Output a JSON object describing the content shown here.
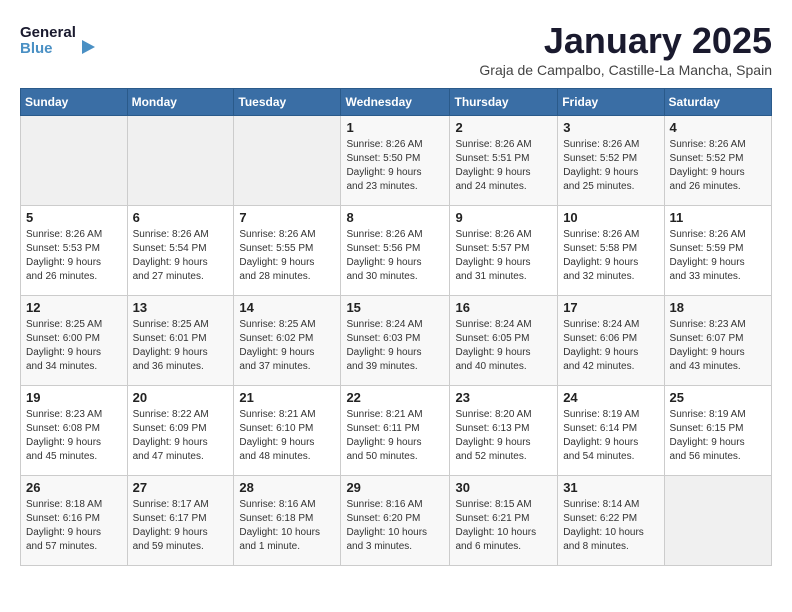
{
  "logo": {
    "line1": "General",
    "line2": "Blue"
  },
  "title": "January 2025",
  "subtitle": "Graja de Campalbo, Castille-La Mancha, Spain",
  "days_of_week": [
    "Sunday",
    "Monday",
    "Tuesday",
    "Wednesday",
    "Thursday",
    "Friday",
    "Saturday"
  ],
  "weeks": [
    [
      {
        "day": "",
        "info": ""
      },
      {
        "day": "",
        "info": ""
      },
      {
        "day": "",
        "info": ""
      },
      {
        "day": "1",
        "info": "Sunrise: 8:26 AM\nSunset: 5:50 PM\nDaylight: 9 hours\nand 23 minutes."
      },
      {
        "day": "2",
        "info": "Sunrise: 8:26 AM\nSunset: 5:51 PM\nDaylight: 9 hours\nand 24 minutes."
      },
      {
        "day": "3",
        "info": "Sunrise: 8:26 AM\nSunset: 5:52 PM\nDaylight: 9 hours\nand 25 minutes."
      },
      {
        "day": "4",
        "info": "Sunrise: 8:26 AM\nSunset: 5:52 PM\nDaylight: 9 hours\nand 26 minutes."
      }
    ],
    [
      {
        "day": "5",
        "info": "Sunrise: 8:26 AM\nSunset: 5:53 PM\nDaylight: 9 hours\nand 26 minutes."
      },
      {
        "day": "6",
        "info": "Sunrise: 8:26 AM\nSunset: 5:54 PM\nDaylight: 9 hours\nand 27 minutes."
      },
      {
        "day": "7",
        "info": "Sunrise: 8:26 AM\nSunset: 5:55 PM\nDaylight: 9 hours\nand 28 minutes."
      },
      {
        "day": "8",
        "info": "Sunrise: 8:26 AM\nSunset: 5:56 PM\nDaylight: 9 hours\nand 30 minutes."
      },
      {
        "day": "9",
        "info": "Sunrise: 8:26 AM\nSunset: 5:57 PM\nDaylight: 9 hours\nand 31 minutes."
      },
      {
        "day": "10",
        "info": "Sunrise: 8:26 AM\nSunset: 5:58 PM\nDaylight: 9 hours\nand 32 minutes."
      },
      {
        "day": "11",
        "info": "Sunrise: 8:26 AM\nSunset: 5:59 PM\nDaylight: 9 hours\nand 33 minutes."
      }
    ],
    [
      {
        "day": "12",
        "info": "Sunrise: 8:25 AM\nSunset: 6:00 PM\nDaylight: 9 hours\nand 34 minutes."
      },
      {
        "day": "13",
        "info": "Sunrise: 8:25 AM\nSunset: 6:01 PM\nDaylight: 9 hours\nand 36 minutes."
      },
      {
        "day": "14",
        "info": "Sunrise: 8:25 AM\nSunset: 6:02 PM\nDaylight: 9 hours\nand 37 minutes."
      },
      {
        "day": "15",
        "info": "Sunrise: 8:24 AM\nSunset: 6:03 PM\nDaylight: 9 hours\nand 39 minutes."
      },
      {
        "day": "16",
        "info": "Sunrise: 8:24 AM\nSunset: 6:05 PM\nDaylight: 9 hours\nand 40 minutes."
      },
      {
        "day": "17",
        "info": "Sunrise: 8:24 AM\nSunset: 6:06 PM\nDaylight: 9 hours\nand 42 minutes."
      },
      {
        "day": "18",
        "info": "Sunrise: 8:23 AM\nSunset: 6:07 PM\nDaylight: 9 hours\nand 43 minutes."
      }
    ],
    [
      {
        "day": "19",
        "info": "Sunrise: 8:23 AM\nSunset: 6:08 PM\nDaylight: 9 hours\nand 45 minutes."
      },
      {
        "day": "20",
        "info": "Sunrise: 8:22 AM\nSunset: 6:09 PM\nDaylight: 9 hours\nand 47 minutes."
      },
      {
        "day": "21",
        "info": "Sunrise: 8:21 AM\nSunset: 6:10 PM\nDaylight: 9 hours\nand 48 minutes."
      },
      {
        "day": "22",
        "info": "Sunrise: 8:21 AM\nSunset: 6:11 PM\nDaylight: 9 hours\nand 50 minutes."
      },
      {
        "day": "23",
        "info": "Sunrise: 8:20 AM\nSunset: 6:13 PM\nDaylight: 9 hours\nand 52 minutes."
      },
      {
        "day": "24",
        "info": "Sunrise: 8:19 AM\nSunset: 6:14 PM\nDaylight: 9 hours\nand 54 minutes."
      },
      {
        "day": "25",
        "info": "Sunrise: 8:19 AM\nSunset: 6:15 PM\nDaylight: 9 hours\nand 56 minutes."
      }
    ],
    [
      {
        "day": "26",
        "info": "Sunrise: 8:18 AM\nSunset: 6:16 PM\nDaylight: 9 hours\nand 57 minutes."
      },
      {
        "day": "27",
        "info": "Sunrise: 8:17 AM\nSunset: 6:17 PM\nDaylight: 9 hours\nand 59 minutes."
      },
      {
        "day": "28",
        "info": "Sunrise: 8:16 AM\nSunset: 6:18 PM\nDaylight: 10 hours\nand 1 minute."
      },
      {
        "day": "29",
        "info": "Sunrise: 8:16 AM\nSunset: 6:20 PM\nDaylight: 10 hours\nand 3 minutes."
      },
      {
        "day": "30",
        "info": "Sunrise: 8:15 AM\nSunset: 6:21 PM\nDaylight: 10 hours\nand 6 minutes."
      },
      {
        "day": "31",
        "info": "Sunrise: 8:14 AM\nSunset: 6:22 PM\nDaylight: 10 hours\nand 8 minutes."
      },
      {
        "day": "",
        "info": ""
      }
    ]
  ]
}
